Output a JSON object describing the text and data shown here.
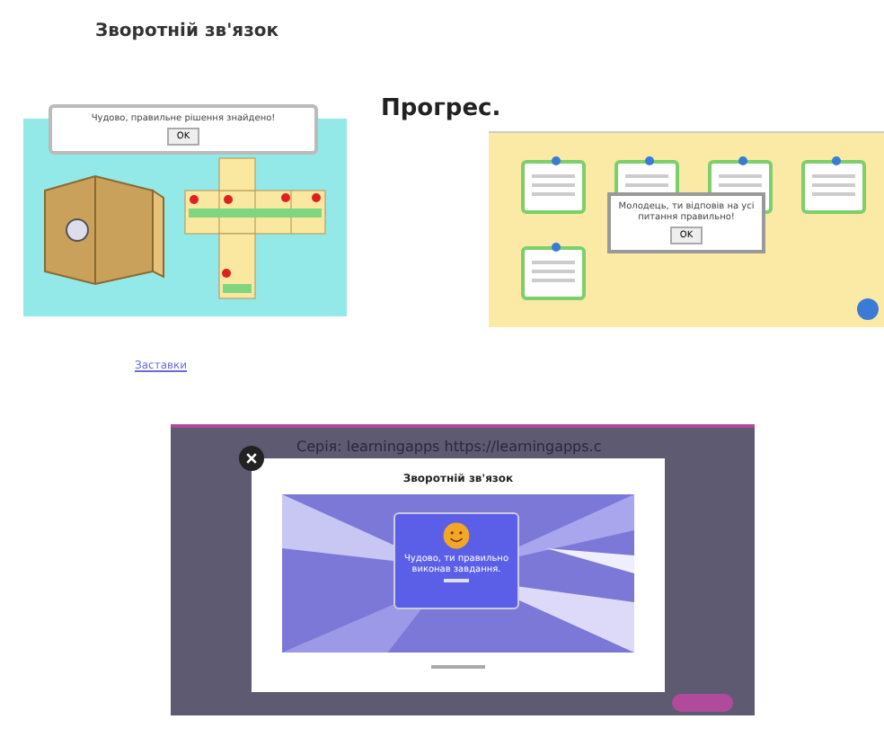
{
  "heading": "Зворотній зв'язок",
  "feedback_example": {
    "dialog": {
      "message": "Чудово, правильне рішення знайдено!",
      "button": "OK"
    }
  },
  "progress_heading": "Прогрес.",
  "progress_example": {
    "dialog": {
      "message": "Молодець, ти відповів на усі питання правильно!",
      "button": "OK"
    }
  },
  "link": "Заставки",
  "modal_example": {
    "series_line": "Серія: learningapps https://learningapps.c",
    "title": "Зворотній зв'язок",
    "message": "Чудово, ти правильно виконав завдання."
  }
}
